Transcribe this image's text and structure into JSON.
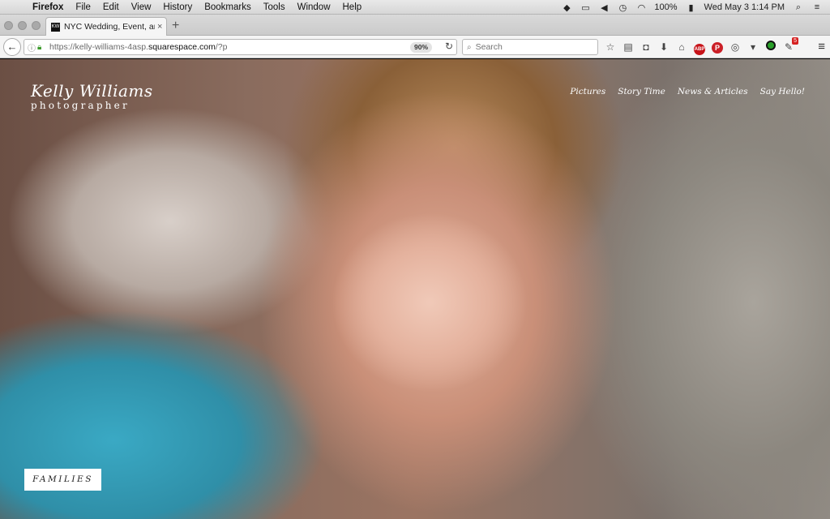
{
  "menubar": {
    "apple": "",
    "items": [
      "Firefox",
      "File",
      "Edit",
      "View",
      "History",
      "Bookmarks",
      "Tools",
      "Window",
      "Help"
    ],
    "battery": "100%",
    "clock": "Wed May 3  1:14 PM"
  },
  "tab": {
    "favicon": "KW",
    "title": "NYC Wedding, Event, and Por",
    "close": "×",
    "new_tab": "+"
  },
  "navbar": {
    "back": "←",
    "url_prefix": "https://kelly-williams-4asp.",
    "url_host": "squarespace.com",
    "url_suffix": "/?p",
    "zoom": "90%",
    "reload": "↻",
    "search_placeholder": "Search",
    "notification_count": "5",
    "abp_label": "ABP",
    "pinterest_label": "P"
  },
  "site": {
    "logo_name": "Kelly Williams",
    "logo_sub": "photographer",
    "nav": [
      "Pictures",
      "Story Time",
      "News & Articles",
      "Say Hello!"
    ],
    "gallery_label": "FAMILIES"
  },
  "icons": {
    "status": [
      "dropbox-icon",
      "airplay-icon",
      "volume-icon",
      "time-machine-icon",
      "wifi-icon",
      "battery-icon"
    ],
    "toolbar": [
      "bookmark-star-icon",
      "reader-icon",
      "pocket-icon",
      "download-icon",
      "home-icon",
      "adblock-icon",
      "pinterest-icon",
      "extension-icon",
      "status-dot-icon",
      "notification-icon"
    ]
  }
}
